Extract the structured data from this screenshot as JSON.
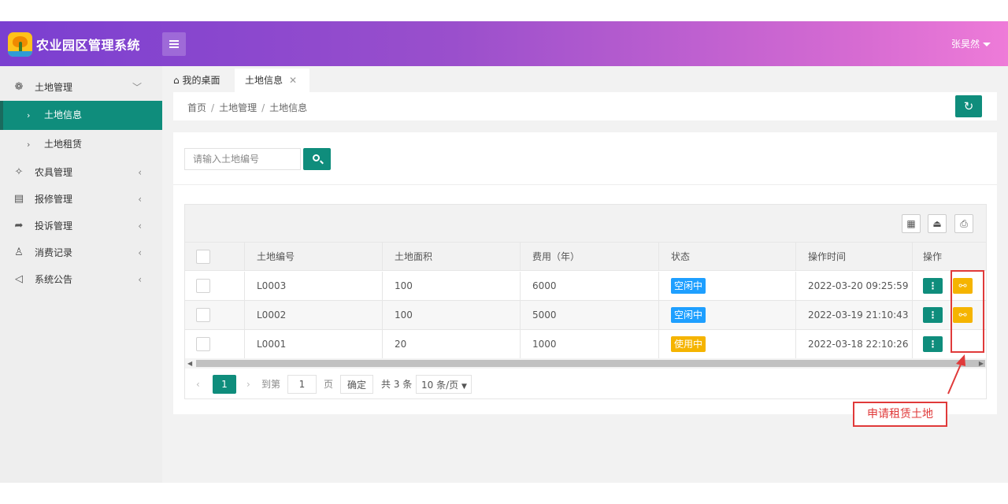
{
  "header": {
    "app_title": "农业园区管理系统",
    "user_name": "张昊然",
    "logo_icon": "palm-island-logo",
    "gradient_colors": [
      "#7a3fd0",
      "#ee7bd8"
    ]
  },
  "sidebar": {
    "items": [
      {
        "label": "土地管理",
        "icon": "clover-icon",
        "expanded": true,
        "children": [
          {
            "label": "土地信息",
            "active": true
          },
          {
            "label": "土地租赁",
            "active": false
          }
        ]
      },
      {
        "label": "农具管理",
        "icon": "pin-icon"
      },
      {
        "label": "报修管理",
        "icon": "form-icon"
      },
      {
        "label": "投诉管理",
        "icon": "share-icon"
      },
      {
        "label": "消费记录",
        "icon": "user-icon"
      },
      {
        "label": "系统公告",
        "icon": "speaker-icon"
      }
    ]
  },
  "tabs": {
    "home": "我的桌面",
    "active": "土地信息"
  },
  "breadcrumb": {
    "items": [
      "首页",
      "土地管理",
      "土地信息"
    ]
  },
  "search": {
    "placeholder": "请输入土地编号",
    "value": ""
  },
  "table": {
    "columns": [
      "土地编号",
      "土地面积",
      "费用（年）",
      "状态",
      "操作时间",
      "操作"
    ],
    "rows": [
      {
        "id": "L0003",
        "area": "100",
        "fee": "6000",
        "status": "空闲中",
        "status_color": "#1e9fff",
        "time": "2022-03-20 09:25:59",
        "rentable": true
      },
      {
        "id": "L0002",
        "area": "100",
        "fee": "5000",
        "status": "空闲中",
        "status_color": "#1e9fff",
        "time": "2022-03-19 21:10:43",
        "rentable": true
      },
      {
        "id": "L0001",
        "area": "20",
        "fee": "1000",
        "status": "使用中",
        "status_color": "#f5b400",
        "time": "2022-03-18 22:10:26",
        "rentable": false
      }
    ]
  },
  "pager": {
    "current_page": "1",
    "goto_label": "到第",
    "goto_value": "1",
    "page_unit": "页",
    "confirm": "确定",
    "total": "共 3 条",
    "page_size": "10 条/页"
  },
  "annotation": {
    "callout": "申请租赁土地",
    "color": "#e03a3a"
  },
  "colors": {
    "primary": "#0f8d7c",
    "warning": "#f5b400",
    "info": "#1e9fff"
  }
}
